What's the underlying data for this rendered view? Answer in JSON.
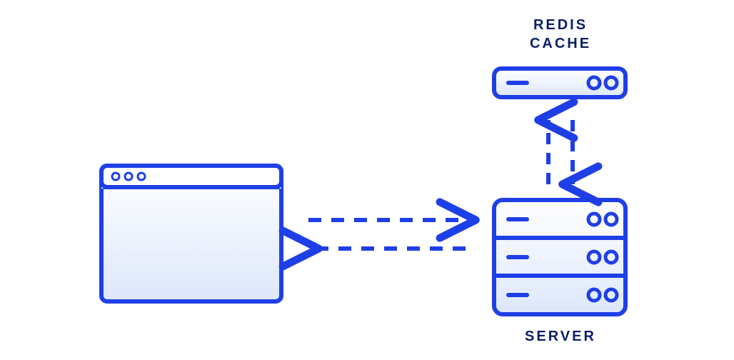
{
  "labels": {
    "redis_cache_line1": "REDIS",
    "redis_cache_line2": "CACHE",
    "server": "SERVER"
  },
  "nodes": {
    "client": {
      "type": "browser-window",
      "role": "client"
    },
    "redis_cache": {
      "type": "single-rack-unit",
      "role": "cache"
    },
    "server": {
      "type": "server-stack",
      "role": "origin-server"
    }
  },
  "edges": [
    {
      "from": "client",
      "to": "server",
      "bidirectional": true,
      "style": "dashed"
    },
    {
      "from": "server",
      "to": "redis_cache",
      "bidirectional": true,
      "style": "dashed"
    }
  ],
  "colors": {
    "stroke": "#1F3FE6",
    "label": "#0B1F66",
    "fill_grad_start": "#FFFFFF",
    "fill_grad_end": "#DDE7FB"
  }
}
